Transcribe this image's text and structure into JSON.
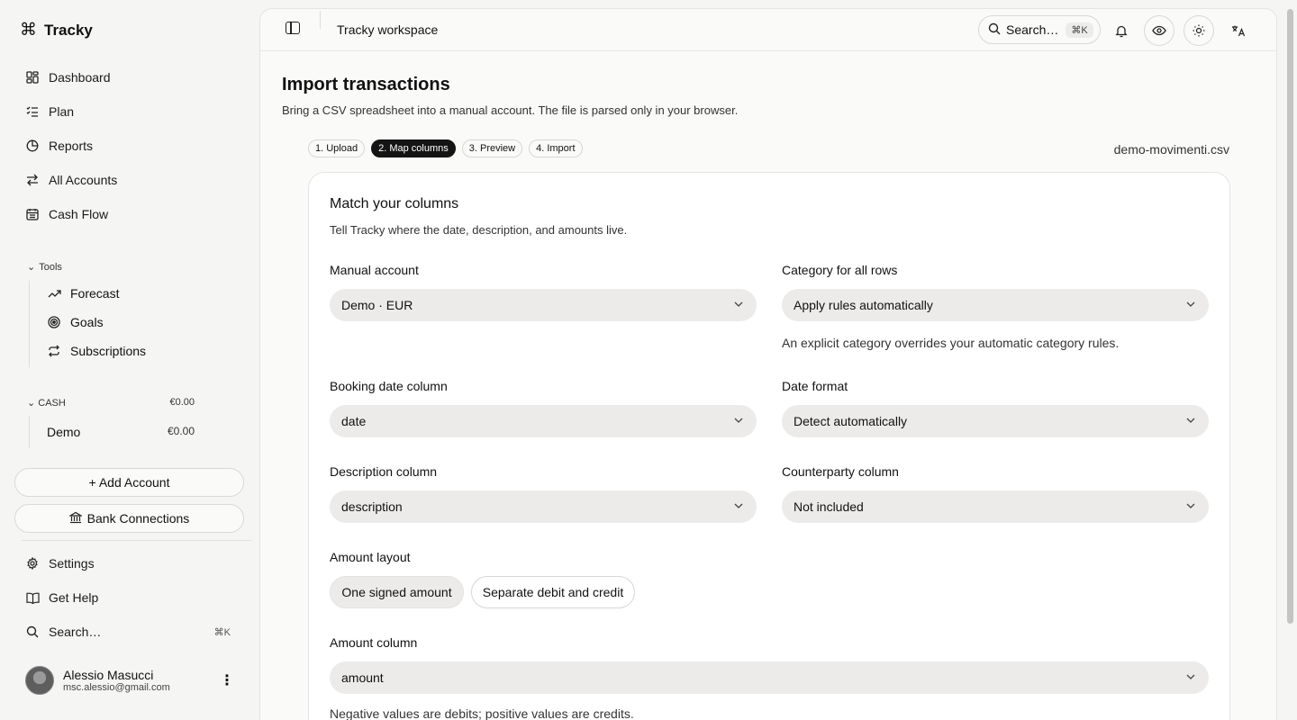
{
  "app": {
    "name": "Tracky"
  },
  "sidebar": {
    "nav": [
      {
        "label": "Dashboard",
        "icon": "dashboard-icon"
      },
      {
        "label": "Plan",
        "icon": "list-icon"
      },
      {
        "label": "Reports",
        "icon": "pie-chart-icon"
      },
      {
        "label": "All Accounts",
        "icon": "transfer-icon"
      },
      {
        "label": "Cash Flow",
        "icon": "calendar-icon"
      }
    ],
    "tools": {
      "label": "Tools",
      "items": [
        {
          "label": "Forecast",
          "icon": "trend-up-icon"
        },
        {
          "label": "Goals",
          "icon": "target-icon"
        },
        {
          "label": "Subscriptions",
          "icon": "repeat-icon"
        }
      ]
    },
    "cash": {
      "label": "CASH",
      "total": "€0.00",
      "accounts": [
        {
          "name": "Demo",
          "amount": "€0.00"
        }
      ]
    },
    "add_account": "+ Add Account",
    "bank_connections": "Bank Connections",
    "bottom": [
      {
        "label": "Settings",
        "icon": "gear-icon"
      },
      {
        "label": "Get Help",
        "icon": "book-icon"
      }
    ],
    "search": {
      "label": "Search…",
      "shortcut": "⌘K"
    },
    "user": {
      "name": "Alessio Masucci",
      "email": "msc.alessio@gmail.com"
    }
  },
  "topbar": {
    "workspace": "Tracky workspace",
    "search_label": "Search…",
    "search_shortcut": "⌘K"
  },
  "page": {
    "title": "Import transactions",
    "subtitle": "Bring a CSV spreadsheet into a manual account. The file is parsed only in your browser.",
    "steps": [
      {
        "label": "1. Upload",
        "active": false
      },
      {
        "label": "2. Map columns",
        "active": true
      },
      {
        "label": "3. Preview",
        "active": false
      },
      {
        "label": "4. Import",
        "active": false
      }
    ],
    "filename": "demo-movimenti.csv"
  },
  "card": {
    "title": "Match your columns",
    "subtitle": "Tell Tracky where the date, description, and amounts live.",
    "manual_account": {
      "label": "Manual account",
      "value": "Demo · EUR"
    },
    "category": {
      "label": "Category for all rows",
      "value": "Apply rules automatically",
      "hint": "An explicit category overrides your automatic category rules."
    },
    "booking_date": {
      "label": "Booking date column",
      "value": "date"
    },
    "date_format": {
      "label": "Date format",
      "value": "Detect automatically"
    },
    "description": {
      "label": "Description column",
      "value": "description"
    },
    "counterparty": {
      "label": "Counterparty column",
      "value": "Not included"
    },
    "amount_layout": {
      "label": "Amount layout",
      "options": [
        "One signed amount",
        "Separate debit and credit"
      ],
      "selected": "One signed amount"
    },
    "amount_column": {
      "label": "Amount column",
      "value": "amount",
      "hint": "Negative values are debits; positive values are credits."
    }
  }
}
